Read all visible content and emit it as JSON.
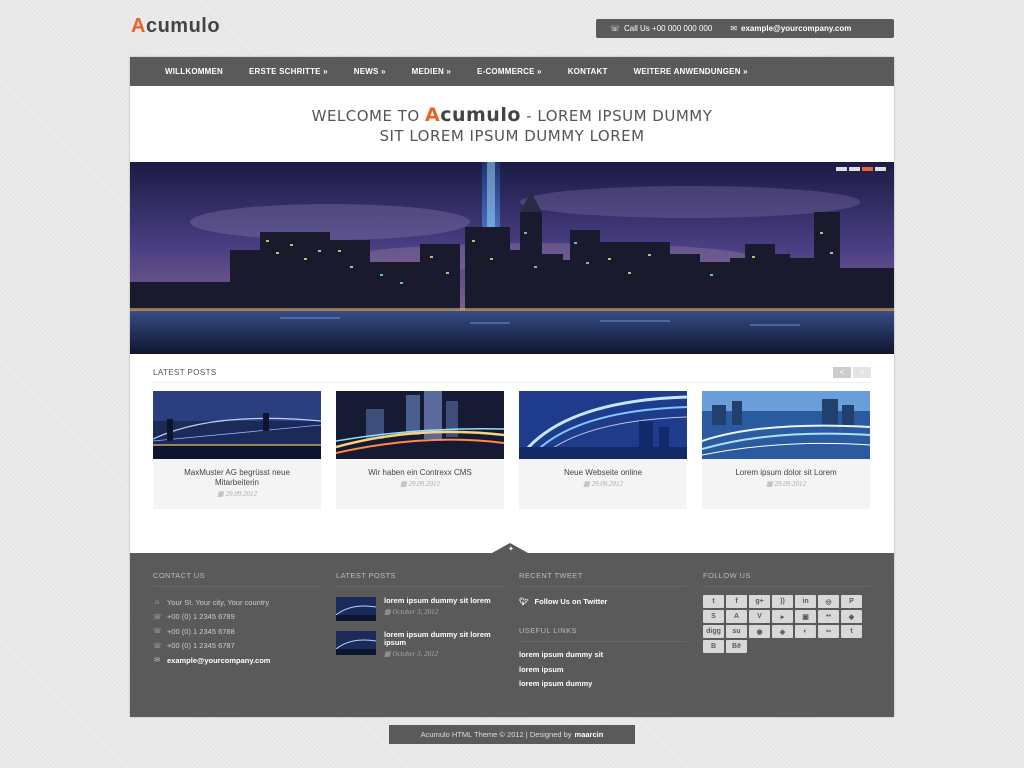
{
  "brand": {
    "logo_text": "Acumulo",
    "logo_accent": "A"
  },
  "contact_bar": {
    "phone": "Call Us +00 000 000 000",
    "email": "example@yourcompany.com"
  },
  "nav": [
    {
      "label": "WILLKOMMEN"
    },
    {
      "label": "ERSTE SCHRITTE »"
    },
    {
      "label": "NEWS »"
    },
    {
      "label": "MEDIEN »"
    },
    {
      "label": "E-COMMERCE »"
    },
    {
      "label": "KONTAKT"
    },
    {
      "label": "WEITERE ANWENDUNGEN »"
    }
  ],
  "welcome": {
    "prefix": "WELCOME TO",
    "brand_accent": "A",
    "brand_rest": "cumulo",
    "suffix": "- LOREM IPSUM DUMMY",
    "line2": "SIT LOREM IPSUM DUMMY LOREM"
  },
  "slider": {
    "slides": 4,
    "active_slide": 3
  },
  "latest_posts": {
    "title": "LATEST POSTS",
    "prev": "<",
    "next": ">",
    "items": [
      {
        "title": "MaxMuster AG begrüsst neue Mitarbeiterin",
        "date": "29.09.2012"
      },
      {
        "title": "Wir haben ein Contrexx CMS",
        "date": "29.09.2012"
      },
      {
        "title": "Neue Webseite online",
        "date": "29.09.2012"
      },
      {
        "title": "Lorem ipsum dolor sit Lorem",
        "date": "29.09.2012"
      }
    ]
  },
  "footer": {
    "contact": {
      "title": "CONTACT US",
      "address": "Your St. Your city, Your country",
      "phone1": "+00 (0) 1 2345 6789",
      "phone2": "+00 (0) 1 2345 6788",
      "fax": "+00 (0) 1 2345 6787",
      "email": "example@yourcompany.com"
    },
    "latest_posts": {
      "title": "LATEST POSTS",
      "items": [
        {
          "title": "lorem ipsum dummy sit lorem",
          "date": "October 3, 2012"
        },
        {
          "title": "lorem ipsum dummy sit lorem ipsum",
          "date": "October 3, 2012"
        }
      ]
    },
    "recent_tweet": {
      "title": "RECENT TWEET",
      "follow": "Follow Us on Twitter"
    },
    "useful_links": {
      "title": "USEFUL LINKS",
      "items": [
        "lorem ipsum dummy sit",
        "lorem ipsum",
        "lorem ipsum dummy"
      ]
    },
    "follow_us": {
      "title": "FOLLOW US",
      "icons": [
        {
          "name": "twitter-icon",
          "glyph": "t"
        },
        {
          "name": "facebook-icon",
          "glyph": "f"
        },
        {
          "name": "google-plus-icon",
          "glyph": "g+"
        },
        {
          "name": "rss-icon",
          "glyph": "))"
        },
        {
          "name": "linkedin-icon",
          "glyph": "in"
        },
        {
          "name": "dribbble-icon",
          "glyph": "◎"
        },
        {
          "name": "pinterest-icon",
          "glyph": "P"
        },
        {
          "name": "skype-icon",
          "glyph": "S"
        },
        {
          "name": "forrst-icon",
          "glyph": "A"
        },
        {
          "name": "vimeo-icon",
          "glyph": "V"
        },
        {
          "name": "youtube-icon",
          "glyph": "▸"
        },
        {
          "name": "picasa-icon",
          "glyph": "▣"
        },
        {
          "name": "flickr-icon",
          "glyph": "••"
        },
        {
          "name": "delicious-icon",
          "glyph": "◆"
        },
        {
          "name": "digg-icon",
          "glyph": "digg"
        },
        {
          "name": "stumbleupon-icon",
          "glyph": "su"
        },
        {
          "name": "reddit-icon",
          "glyph": "◉"
        },
        {
          "name": "dropbox-icon",
          "glyph": "◈"
        },
        {
          "name": "myspace-icon",
          "glyph": "◐"
        },
        {
          "name": "lastfm-icon",
          "glyph": "∞"
        },
        {
          "name": "tumblr-icon",
          "glyph": "t"
        },
        {
          "name": "blogger-icon",
          "glyph": "B"
        },
        {
          "name": "behance-icon",
          "glyph": "Bē"
        }
      ]
    }
  },
  "copyright": {
    "text": "Acumulo HTML Theme © 2012 | Designed by",
    "author": "maarcin"
  },
  "colors": {
    "accent": "#e8622a",
    "dark": "#5a5a5a"
  }
}
